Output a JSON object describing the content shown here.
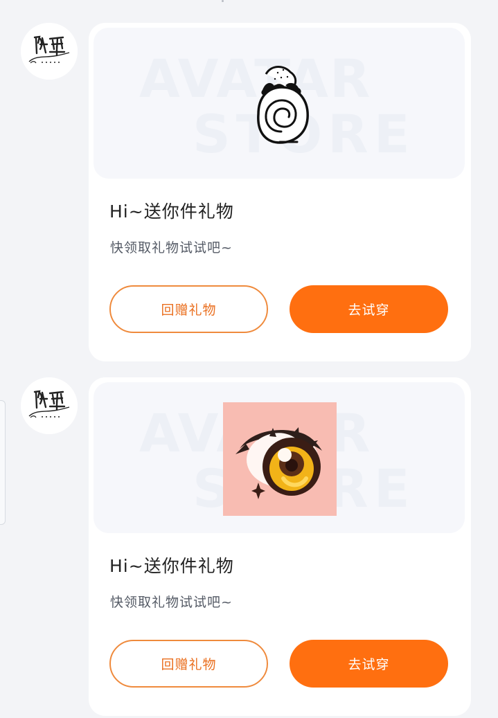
{
  "colors": {
    "page_background": "#f3f4f7",
    "card_background": "#ffffff",
    "preview_background": "#f6f7fb",
    "accent": "#ff6f10",
    "accent_outline": "#ef8a3c",
    "title_text": "#222222",
    "subtitle_text": "#555b66"
  },
  "sender": {
    "avatar_text": "阿望"
  },
  "messages": [
    {
      "preview": {
        "watermark_top": "AVATAR",
        "watermark_bottom": "STORE",
        "item_icon": "snail-shell-hat-icon"
      },
      "title": "Hi~送你件礼物",
      "subtitle": "快领取礼物试试吧~",
      "buttons": {
        "gift_back": "回赠礼物",
        "try_on": "去试穿"
      }
    },
    {
      "preview": {
        "watermark_top": "AVATAR",
        "watermark_bottom": "STORE",
        "item_icon": "anime-eye-icon"
      },
      "title": "Hi~送你件礼物",
      "subtitle": "快领取礼物试试吧~",
      "buttons": {
        "gift_back": "回赠礼物",
        "try_on": "去试穿"
      }
    }
  ]
}
